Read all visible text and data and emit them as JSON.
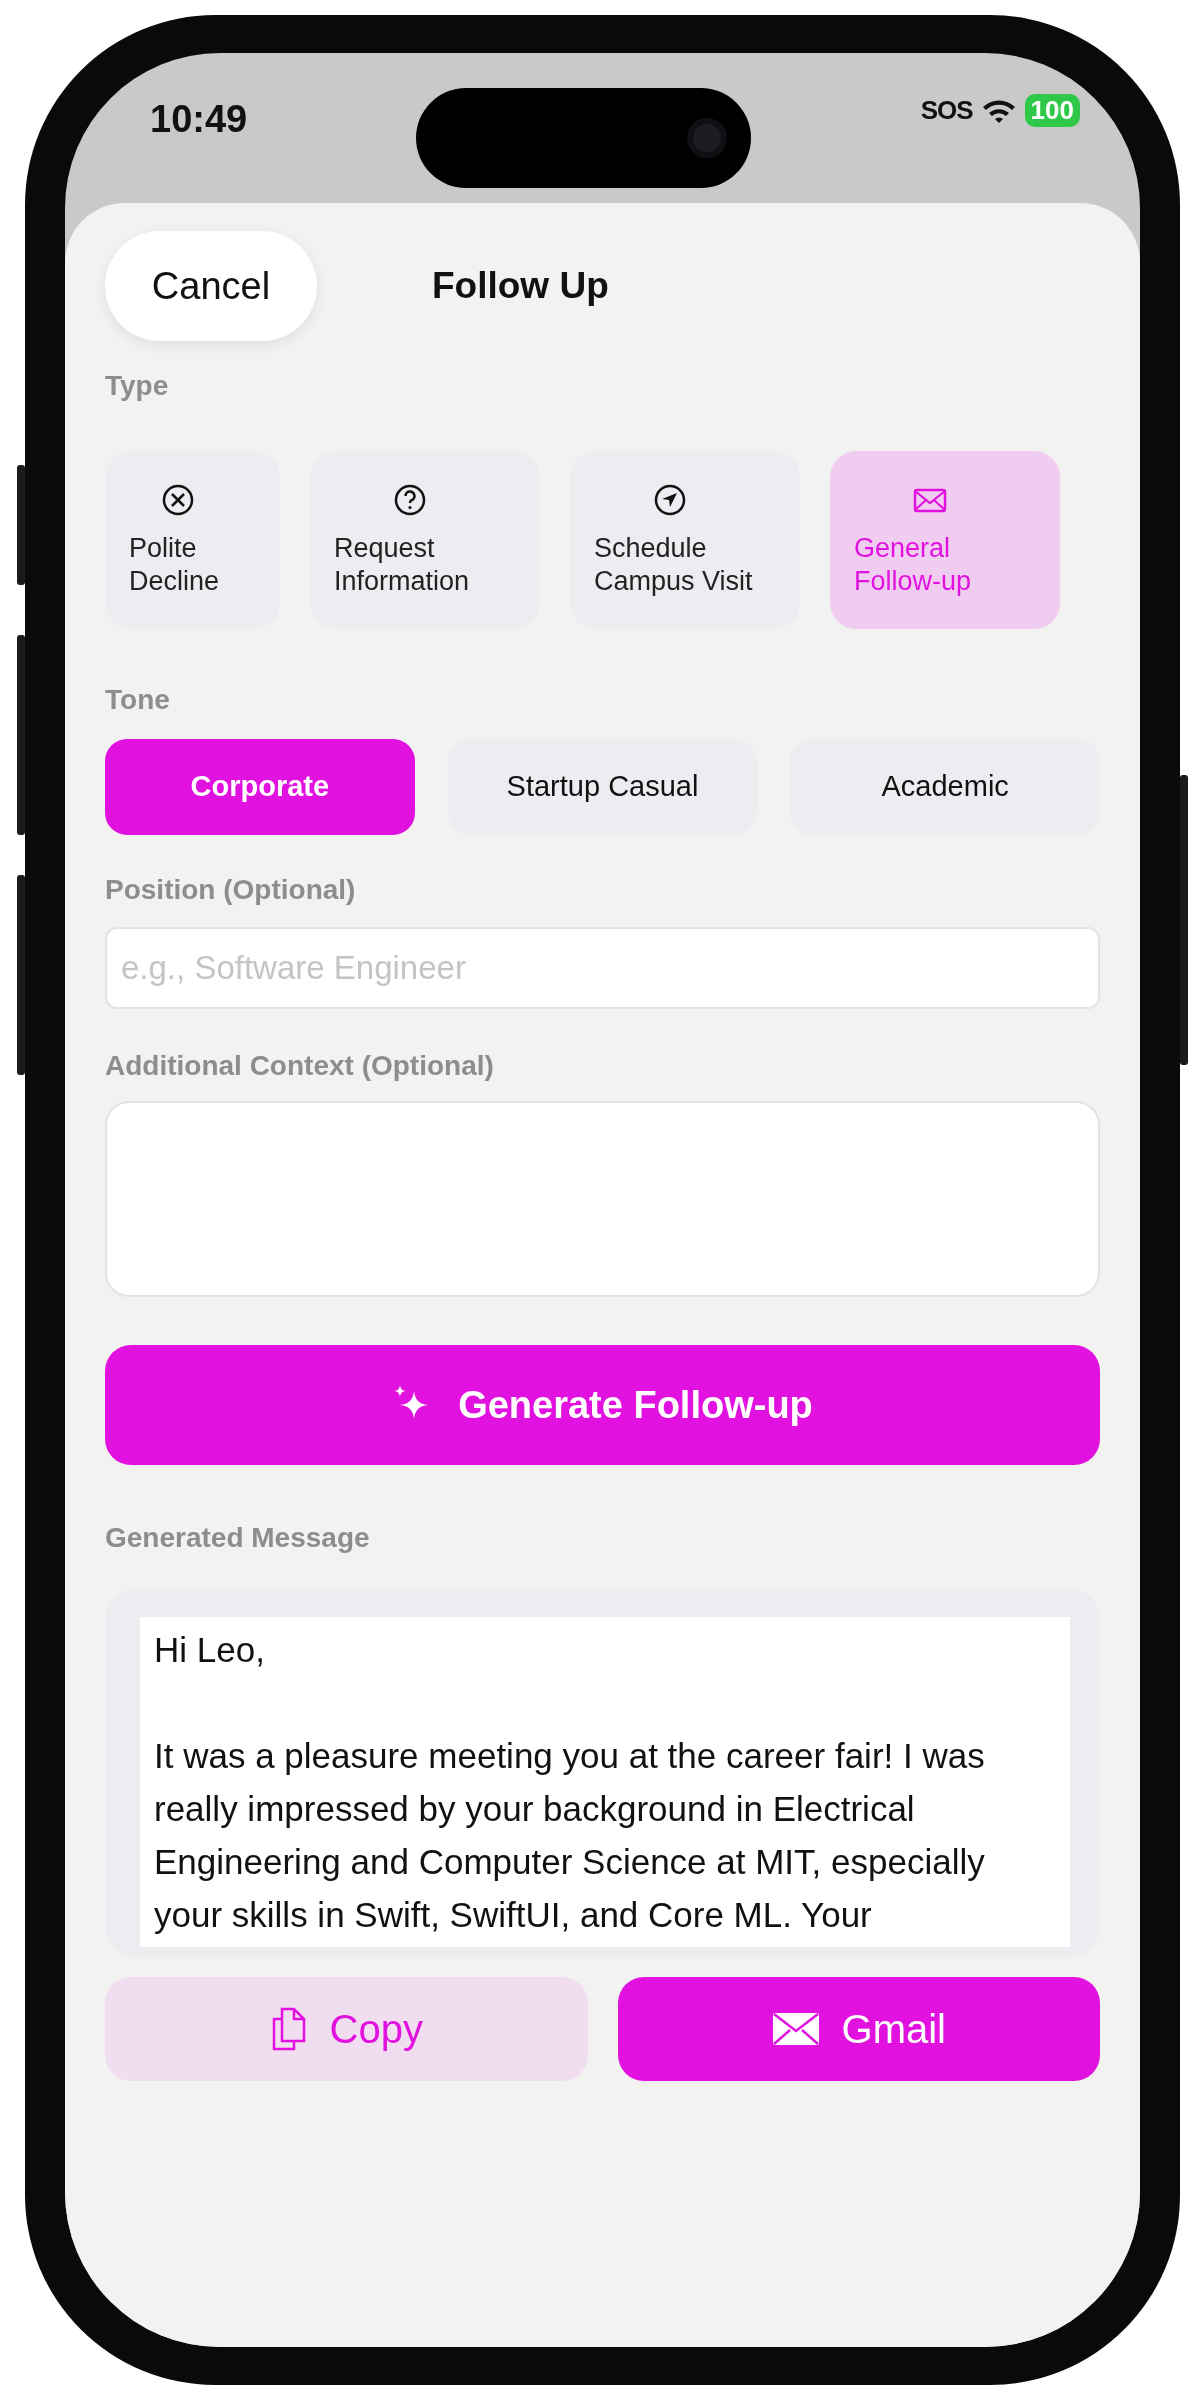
{
  "status_bar": {
    "time": "10:49",
    "carrier": "SOS",
    "battery": "100"
  },
  "header": {
    "cancel": "Cancel",
    "title": "Follow Up"
  },
  "type": {
    "label": "Type",
    "options": [
      {
        "label": "Polite Decline",
        "selected": false
      },
      {
        "label": "Request Information",
        "selected": false
      },
      {
        "label": "Schedule Campus Visit",
        "selected": false
      },
      {
        "label": "General Follow-up",
        "selected": true
      }
    ]
  },
  "tone": {
    "label": "Tone",
    "options": [
      {
        "label": "Corporate",
        "selected": true
      },
      {
        "label": "Startup Casual",
        "selected": false
      },
      {
        "label": "Academic",
        "selected": false
      }
    ]
  },
  "position": {
    "label": "Position (Optional)",
    "placeholder": "e.g., Software Engineer"
  },
  "context": {
    "label": "Additional Context (Optional)"
  },
  "generate_button": {
    "label": "Generate Follow-up"
  },
  "generated": {
    "label": "Generated Message",
    "text": "Hi Leo,\n\nIt was a pleasure meeting you at the career fair! I was really impressed by your background in Electrical Engineering and Computer Science at MIT, especially your skills in Swift, SwiftUI, and Core ML. Your"
  },
  "actions": [
    {
      "label": "Copy",
      "kind": "secondary"
    },
    {
      "label": "Gmail",
      "kind": "primary"
    }
  ]
}
